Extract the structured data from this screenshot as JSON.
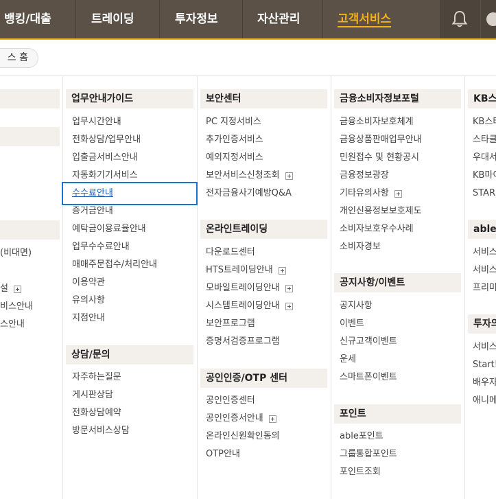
{
  "topnav": {
    "items": [
      {
        "label": "뱅킹/대출"
      },
      {
        "label": "트레이딩"
      },
      {
        "label": "투자정보"
      },
      {
        "label": "자산관리"
      },
      {
        "label": "고객서비스"
      }
    ]
  },
  "breadcrumb": {
    "home": "스 홈"
  },
  "col0": {
    "items": [
      "(비대면)",
      "설",
      "비스안내",
      "스안내"
    ]
  },
  "col1": {
    "sec1": {
      "title": "업무안내가이드",
      "items": [
        "업무시간안내",
        "전화상담/업무안내",
        "입출금서비스안내",
        "자동화기기서비스",
        "수수료안내",
        "증거금안내",
        "예탁금이용료율안내",
        "업무수수료안내",
        "매매주문접수/처리안내",
        "이용약관",
        "유의사항",
        "지점안내"
      ]
    },
    "sec2": {
      "title": "상담/문의",
      "items": [
        "자주하는질문",
        "게시판상담",
        "전화상담예약",
        "방문서비스상담"
      ]
    }
  },
  "col2": {
    "sec1": {
      "title": "보안센터",
      "items": [
        "PC 지정서비스",
        "추가인증서비스",
        "예외지정서비스",
        "보안서비스신청조회",
        "전자금융사기예방Q&A"
      ]
    },
    "sec2": {
      "title": "온라인트레이딩",
      "items": [
        "다운로드센터",
        "HTS트레이딩안내",
        "모바일트레이딩안내",
        "시스템트레이딩안내",
        "보안프로그램",
        "증명서검증프로그램"
      ]
    },
    "sec3": {
      "title": "공인인증/OTP 센터",
      "items": [
        "공인인증센터",
        "공인인증서안내",
        "온라인신원확인동의",
        "OTP안내"
      ]
    }
  },
  "col3": {
    "sec1": {
      "title": "금융소비자정보포털",
      "items": [
        "금융소비자보호체계",
        "금융상품판매업무안내",
        "민원접수 및 현황공시",
        "금융정보광장",
        "기타유의사항",
        "개인신용정보보호제도",
        "소비자보호우수사례",
        "소비자경보"
      ]
    },
    "sec2": {
      "title": "공지사항/이벤트",
      "items": [
        "공지사항",
        "이벤트",
        "신규고객이벤트",
        "운세",
        "스마트폰이벤트"
      ]
    },
    "sec3": {
      "title": "포인트",
      "items": [
        "able포인트",
        "그룹통합포인트",
        "포인트조회"
      ]
    }
  },
  "col4": {
    "sec1": {
      "title": "KB스타",
      "items": [
        "KB스타",
        "스타클",
        "우대서",
        "KB마이",
        "STAR+"
      ]
    },
    "sec2": {
      "title": "able I",
      "items": [
        "서비스",
        "서비스",
        "프리미"
      ]
    },
    "sec3": {
      "title": "투자의",
      "items": [
        "서비스",
        "Start!",
        "배우자",
        "애니메"
      ]
    }
  },
  "colors": {
    "nav_bg": "#5b5147",
    "accent": "#f2b21a",
    "section_bg": "#f3f0eb",
    "selected_border": "#1a73d4"
  }
}
